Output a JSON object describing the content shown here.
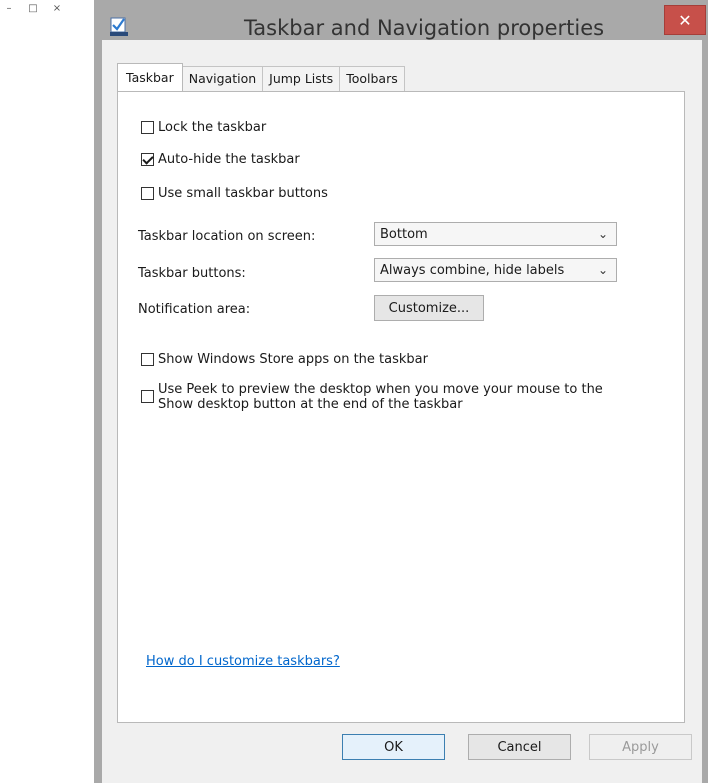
{
  "outer_window": {
    "minimize_glyph": "–",
    "maximize_glyph": "□",
    "close_glyph": "×"
  },
  "dialog": {
    "title": "Taskbar and Navigation properties",
    "close_glyph": "✕"
  },
  "tabs": [
    {
      "label": "Taskbar",
      "active": true
    },
    {
      "label": "Navigation",
      "active": false
    },
    {
      "label": "Jump Lists",
      "active": false
    },
    {
      "label": "Toolbars",
      "active": false
    }
  ],
  "taskbar_tab": {
    "lock_taskbar": {
      "label": "Lock the taskbar",
      "checked": false
    },
    "auto_hide": {
      "label": "Auto-hide the taskbar",
      "checked": true
    },
    "small_buttons": {
      "label": "Use small taskbar buttons",
      "checked": false
    },
    "location": {
      "label": "Taskbar location on screen:",
      "value": "Bottom"
    },
    "buttons": {
      "label": "Taskbar buttons:",
      "value": "Always combine, hide labels"
    },
    "notification": {
      "label": "Notification area:",
      "button": "Customize..."
    },
    "store_apps": {
      "label": "Show Windows Store apps on the taskbar",
      "checked": false
    },
    "peek": {
      "line1": "Use Peek to preview the desktop when you move your mouse to the",
      "line2": "Show desktop button at the end of the taskbar",
      "checked": false
    },
    "help_link": "How do I customize taskbars?"
  },
  "footer": {
    "ok": "OK",
    "cancel": "Cancel",
    "apply": "Apply"
  },
  "colors": {
    "frame": "#a9a9a9",
    "close_button": "#c7504a",
    "link": "#0066cc"
  }
}
